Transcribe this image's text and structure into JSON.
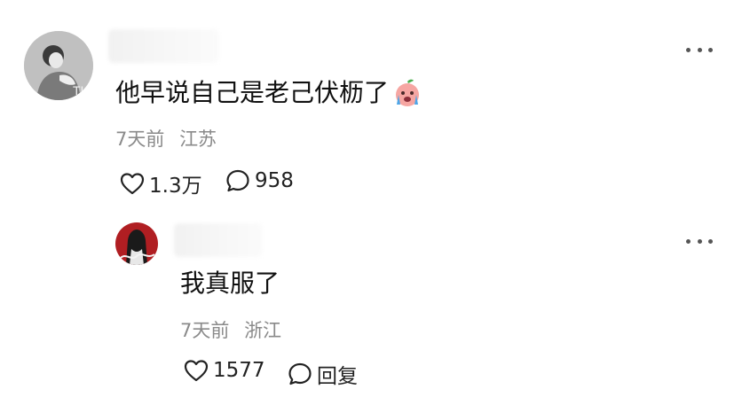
{
  "comment": {
    "text": "他早说自己是老己伏枥了",
    "emoji_icon": "crying-peach-emoji-icon",
    "avatar_icon": "woman-portrait-avatar-icon",
    "time": "7天前",
    "location": "江苏",
    "likes": "1.3万",
    "replies": "958"
  },
  "reply": {
    "text": "我真服了",
    "avatar_icon": "red-figure-avatar-icon",
    "time": "7天前",
    "location": "浙江",
    "likes": "1577",
    "reply_label": "回复"
  },
  "icons": {
    "like": "heart-outline-icon",
    "comment": "speech-bubble-icon",
    "more": "more-dots-icon"
  },
  "colors": {
    "text": "#111111",
    "meta": "#8a8a8a",
    "icon": "#222222"
  }
}
